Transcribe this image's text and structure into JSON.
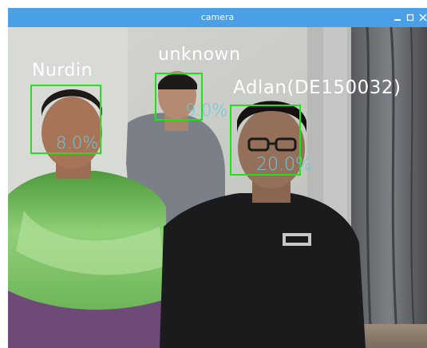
{
  "window": {
    "title": "camera",
    "titlebar_color": "#4a9fe6",
    "controls": {
      "minimize": "minimize-icon",
      "maximize": "maximize-icon",
      "close": "close-icon"
    }
  },
  "detections": [
    {
      "name": "Nurdin",
      "confidence": "8.0%"
    },
    {
      "name": "unknown",
      "confidence": "9.0%"
    },
    {
      "name": "Adlan(DE150032)",
      "confidence": "20.0%"
    }
  ],
  "colors": {
    "box": "#22e01a",
    "name_text": "#ffffff",
    "confidence_text": "#6fc7d6"
  }
}
